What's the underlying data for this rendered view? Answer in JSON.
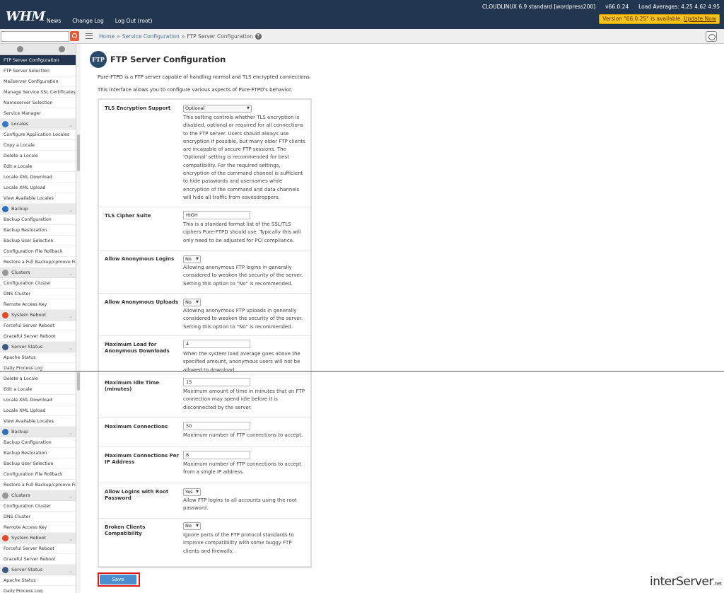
{
  "topbar": {
    "logo": "WHM",
    "nav": [
      "News",
      "Change Log",
      "Log Out (root)"
    ],
    "os": "CLOUDLINUX 6.9 standard [wordpress200]",
    "version": "v66.0.24",
    "load": "Load Averages: 4.25 4.62 4.95",
    "update_text": "Version \"66.0.25\" is available.",
    "update_link": "Update Now"
  },
  "breadcrumb": {
    "home": "Home",
    "sep": "»",
    "section": "Service Configuration",
    "current": "FTP Server Configuration",
    "help": "?"
  },
  "sidebar": {
    "items": [
      {
        "t": "item",
        "label": "FTP Server Configuration",
        "active": true
      },
      {
        "t": "item",
        "label": "FTP Server Selection"
      },
      {
        "t": "item",
        "label": "Mailserver Configuration"
      },
      {
        "t": "item",
        "label": "Manage Service SSL Certificates"
      },
      {
        "t": "item",
        "label": "Nameserver Selection"
      },
      {
        "t": "item",
        "label": "Service Manager"
      },
      {
        "t": "cat",
        "label": "Locales",
        "color": "#3a78c2"
      },
      {
        "t": "item",
        "label": "Configure Application Locales"
      },
      {
        "t": "item",
        "label": "Copy a Locale"
      },
      {
        "t": "item",
        "label": "Delete a Locale"
      },
      {
        "t": "item",
        "label": "Edit a Locale"
      },
      {
        "t": "item",
        "label": "Locale XML Download"
      },
      {
        "t": "item",
        "label": "Locale XML Upload"
      },
      {
        "t": "item",
        "label": "View Available Locales"
      },
      {
        "t": "cat",
        "label": "Backup",
        "color": "#2f6fb8"
      },
      {
        "t": "item",
        "label": "Backup Configuration"
      },
      {
        "t": "item",
        "label": "Backup Restoration"
      },
      {
        "t": "item",
        "label": "Backup User Selection"
      },
      {
        "t": "item",
        "label": "Configuration File Rollback"
      },
      {
        "t": "item",
        "label": "Restore a Full Backup/cpmove File"
      },
      {
        "t": "cat",
        "label": "Clusters",
        "color": "#999999"
      },
      {
        "t": "item",
        "label": "Configuration Cluster"
      },
      {
        "t": "item",
        "label": "DNS Cluster"
      },
      {
        "t": "item",
        "label": "Remote Access Key"
      },
      {
        "t": "cat",
        "label": "System Reboot",
        "color": "#e04a2a"
      },
      {
        "t": "item",
        "label": "Forceful Server Reboot"
      },
      {
        "t": "item",
        "label": "Graceful Server Reboot"
      },
      {
        "t": "cat",
        "label": "Server Status",
        "color": "#3a5a80"
      },
      {
        "t": "item",
        "label": "Apache Status"
      },
      {
        "t": "item",
        "label": "Daily Process Log"
      },
      {
        "t": "item",
        "label": "Delete a Locale"
      },
      {
        "t": "item",
        "label": "Edit a Locale"
      },
      {
        "t": "item",
        "label": "Locale XML Download"
      },
      {
        "t": "item",
        "label": "Locale XML Upload"
      },
      {
        "t": "item",
        "label": "View Available Locales"
      },
      {
        "t": "cat",
        "label": "Backup",
        "color": "#2f6fb8"
      },
      {
        "t": "item",
        "label": "Backup Configuration"
      },
      {
        "t": "item",
        "label": "Backup Restoration"
      },
      {
        "t": "item",
        "label": "Backup User Selection"
      },
      {
        "t": "item",
        "label": "Configuration File Rollback"
      },
      {
        "t": "item",
        "label": "Restore a Full Backup/cpmove File"
      },
      {
        "t": "cat",
        "label": "Clusters",
        "color": "#999999"
      },
      {
        "t": "item",
        "label": "Configuration Cluster"
      },
      {
        "t": "item",
        "label": "DNS Cluster"
      },
      {
        "t": "item",
        "label": "Remote Access Key"
      },
      {
        "t": "cat",
        "label": "System Reboot",
        "color": "#e04a2a"
      },
      {
        "t": "item",
        "label": "Forceful Server Reboot"
      },
      {
        "t": "item",
        "label": "Graceful Server Reboot"
      },
      {
        "t": "cat",
        "label": "Server Status",
        "color": "#3a5a80"
      },
      {
        "t": "item",
        "label": "Apache Status"
      },
      {
        "t": "item",
        "label": "Daily Process Log"
      }
    ]
  },
  "page": {
    "icon_text": "FTP",
    "title": "FTP Server Configuration",
    "intro1": "Pure-FTPD is a FTP server capable of handling normal and TLS encrypted connections.",
    "intro2": "This interface allows you to configure various aspects of Pure-FTPD's behavior."
  },
  "settings": [
    {
      "label": "TLS Encryption Support",
      "control": "select",
      "value": "Optional",
      "desc": "This setting controls whether TLS encryption is disabled, optional or required for all connections to the FTP server. Users should always use encryption if possible, but many older FTP clients are incapable of secure FTP sessions. The 'Optional' setting is recommended for best compatibility. For the required settings, encryption of the command channel is sufficient to hide passwords and usernames while encryption of the command and data channels will hide all traffic from eavesdroppers."
    },
    {
      "label": "TLS Cipher Suite",
      "control": "text",
      "value": "HIGH",
      "desc": "This is a standard format list of the SSL/TLS ciphers Pure-FTPD should use. Typically this will only need to be adjusted for PCI compliance."
    },
    {
      "label": "Allow Anonymous Logins",
      "control": "select",
      "value": "No",
      "desc": "Allowing anonymous FTP logins in generally considered to weaken the security of the server. Setting this option to \"No\" is recommended."
    },
    {
      "label": "Allow Anonymous Uploads",
      "control": "select",
      "value": "No",
      "desc": "Allowing anonymous FTP uploads in generally considered to weaken the security of the server. Setting this option to \"No\" is recommended."
    },
    {
      "label": "Maximum Load for Anonymous Downloads",
      "control": "text",
      "value": "4",
      "desc": "When the system load average goes above the specified amount, anonymous users will not be allowed to download."
    },
    {
      "label": "Maximum Idle Time (minutes)",
      "control": "text",
      "value": "15",
      "desc": "Maximum amount of time in minutes that an FTP connection may spend idle before it is disconnected by the server."
    },
    {
      "label": "Maximum Connections",
      "control": "text",
      "value": "50",
      "desc": "Maximum number of FTP connections to accept."
    },
    {
      "label": "Maximum Connections Per IP Address",
      "control": "text",
      "value": "8",
      "desc": "Maximum number of FTP connections to accept from a single IP address."
    },
    {
      "label": "Allow Logins with Root Password",
      "control": "select",
      "value": "Yes",
      "desc": "Allow FTP logins to all accounts using the root password."
    },
    {
      "label": "Broken Clients Compatibility",
      "control": "select",
      "value": "No",
      "desc": "Ignore parts of the FTP protocol standards to improve compatibility with some buggy FTP clients and firewalls."
    }
  ],
  "save_label": "Save",
  "brand": "interServer",
  "brand_suffix": ".net",
  "colors": {
    "accent": "#22374f",
    "save": "#4a8fd0",
    "highlight": "#e01a1a",
    "banner": "#f0c419"
  }
}
